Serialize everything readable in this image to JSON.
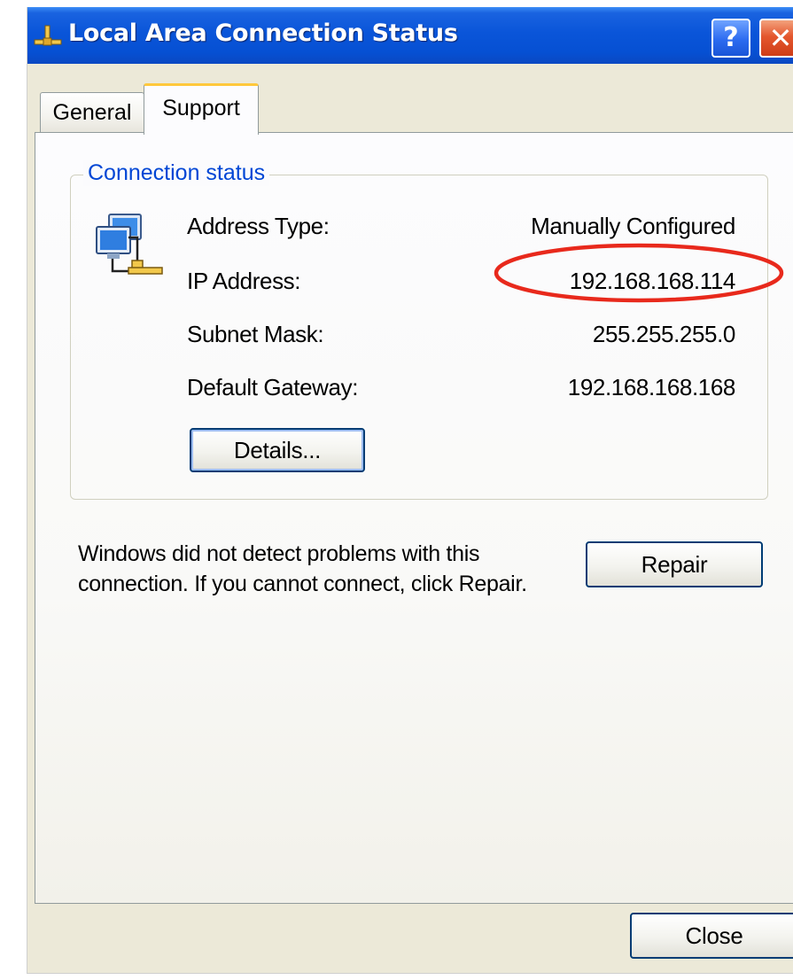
{
  "window": {
    "title": "Local Area Connection Status",
    "help_glyph": "?",
    "close_glyph": "✕"
  },
  "tabs": [
    {
      "label": "General",
      "active": false
    },
    {
      "label": "Support",
      "active": true
    }
  ],
  "connection_status": {
    "legend": "Connection status",
    "icon": "network-connection-icon",
    "rows": [
      {
        "label": "Address Type:",
        "value": "Manually Configured"
      },
      {
        "label": "IP Address:",
        "value": "192.168.168.114"
      },
      {
        "label": "Subnet Mask:",
        "value": "255.255.255.0"
      },
      {
        "label": "Default Gateway:",
        "value": "192.168.168.168"
      }
    ],
    "details_label": "Details..."
  },
  "support": {
    "message": "Windows did not detect problems with this connection. If you cannot connect, click Repair.",
    "repair_label": "Repair"
  },
  "footer": {
    "close_label": "Close"
  },
  "colors": {
    "title_bar": "#0650d3",
    "legend_text": "#0046d5",
    "annotation_circle": "#e8291c",
    "active_tab_accent": "#ffc83c"
  }
}
